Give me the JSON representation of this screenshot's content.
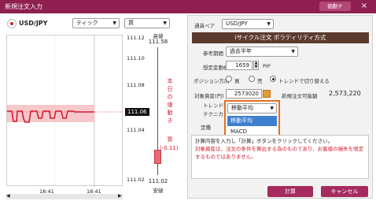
{
  "window": {
    "title": "新規注文入力",
    "move_button": "価動チ",
    "close_icon": "×"
  },
  "left": {
    "pair": "USD/JPY",
    "interval_select": "ティック",
    "side_select": "買",
    "side_indicator": "買",
    "price_ticks": [
      "111.12",
      "111.10",
      "111.08",
      "111.06",
      "111.04",
      "111.02"
    ],
    "current_price": "111.06",
    "high_label": "高値",
    "high_value": "111.58",
    "low_label": "安値",
    "low_value": "111.02",
    "day_change_label": "本日の値動き",
    "day_change_suffix": "買",
    "day_change_value": "(-0.11)",
    "time_labels": [
      "18:41",
      "18:41"
    ],
    "scroll_left": "◀",
    "scroll_right": "▶"
  },
  "right": {
    "pair_label": "通貨ペア",
    "pair_value": "USD/JPY",
    "banner": "iサイクル注文 ボラティリティ方式",
    "period_label": "参考期間",
    "period_value": "過去半年",
    "range_label": "想定変動幅",
    "range_value": "1659",
    "range_unit": "PIP",
    "direction_label": "ポジション方向",
    "direction_options": [
      "買",
      "売",
      "トレンドで切り替える"
    ],
    "direction_selected": 2,
    "capital_label": "対象資産(円)",
    "capital_value": "2573020",
    "capital_max_label": "新規注文可能額",
    "capital_max_value": "2,573,220",
    "trend_label": "トレンド判断",
    "technical_label": "テクニカル",
    "trend_value": "移動平均",
    "dropdown_options": [
      "移動平均",
      "MACD"
    ],
    "teisu_label": "定種",
    "note_line1": "計算内容を入力し「計算」ボタンをクリックしてください。",
    "note_line2": "対象資産は、注文の条件を算出する為のものであり、お客様の損失を限定するものではありません。",
    "calc_button": "計算",
    "cancel_button": "キャンセル"
  },
  "colors": {
    "accent": "#8f1f4f",
    "button": "#a52a5d",
    "price_line": "#d51a2e",
    "highlight": "#e26f21"
  }
}
